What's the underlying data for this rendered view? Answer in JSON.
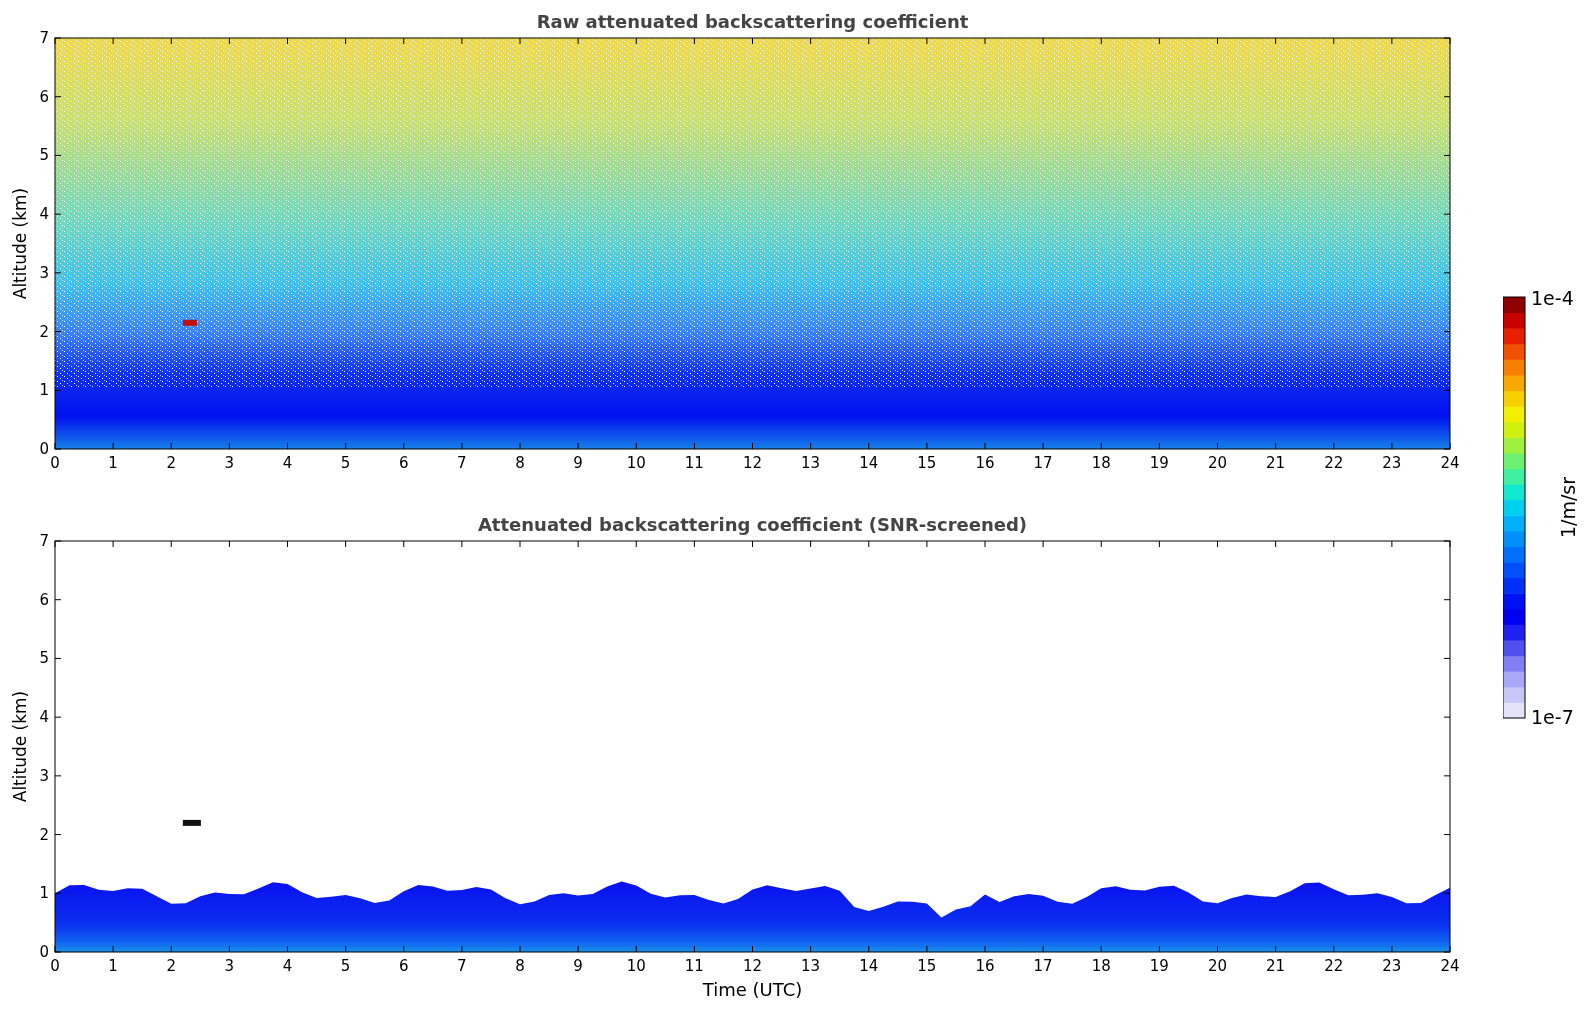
{
  "panels": [
    {
      "kind": "raw",
      "title": "Raw attenuated backscattering coefficient",
      "ylabel": "Altitude (km)",
      "xticks": [
        "0",
        "1",
        "2",
        "3",
        "4",
        "5",
        "6",
        "7",
        "8",
        "9",
        "10",
        "11",
        "12",
        "13",
        "14",
        "15",
        "16",
        "17",
        "18",
        "19",
        "20",
        "21",
        "22",
        "23",
        "24"
      ],
      "yticks": [
        "7",
        "6",
        "5",
        "4",
        "3",
        "2",
        "1",
        "0"
      ]
    },
    {
      "kind": "screened",
      "title": "Attenuated backscattering coefficient (SNR-screened)",
      "ylabel": "Altitude (km)",
      "xlabel": "Time (UTC)",
      "xticks": [
        "0",
        "1",
        "2",
        "3",
        "4",
        "5",
        "6",
        "7",
        "8",
        "9",
        "10",
        "11",
        "12",
        "13",
        "14",
        "15",
        "16",
        "17",
        "18",
        "19",
        "20",
        "21",
        "22",
        "23",
        "24"
      ],
      "yticks": [
        "7",
        "6",
        "5",
        "4",
        "3",
        "2",
        "1",
        "0"
      ]
    }
  ],
  "colorbar": {
    "max_label": "1e-4",
    "min_label": "1e-7",
    "label": "1/m/sr"
  }
}
